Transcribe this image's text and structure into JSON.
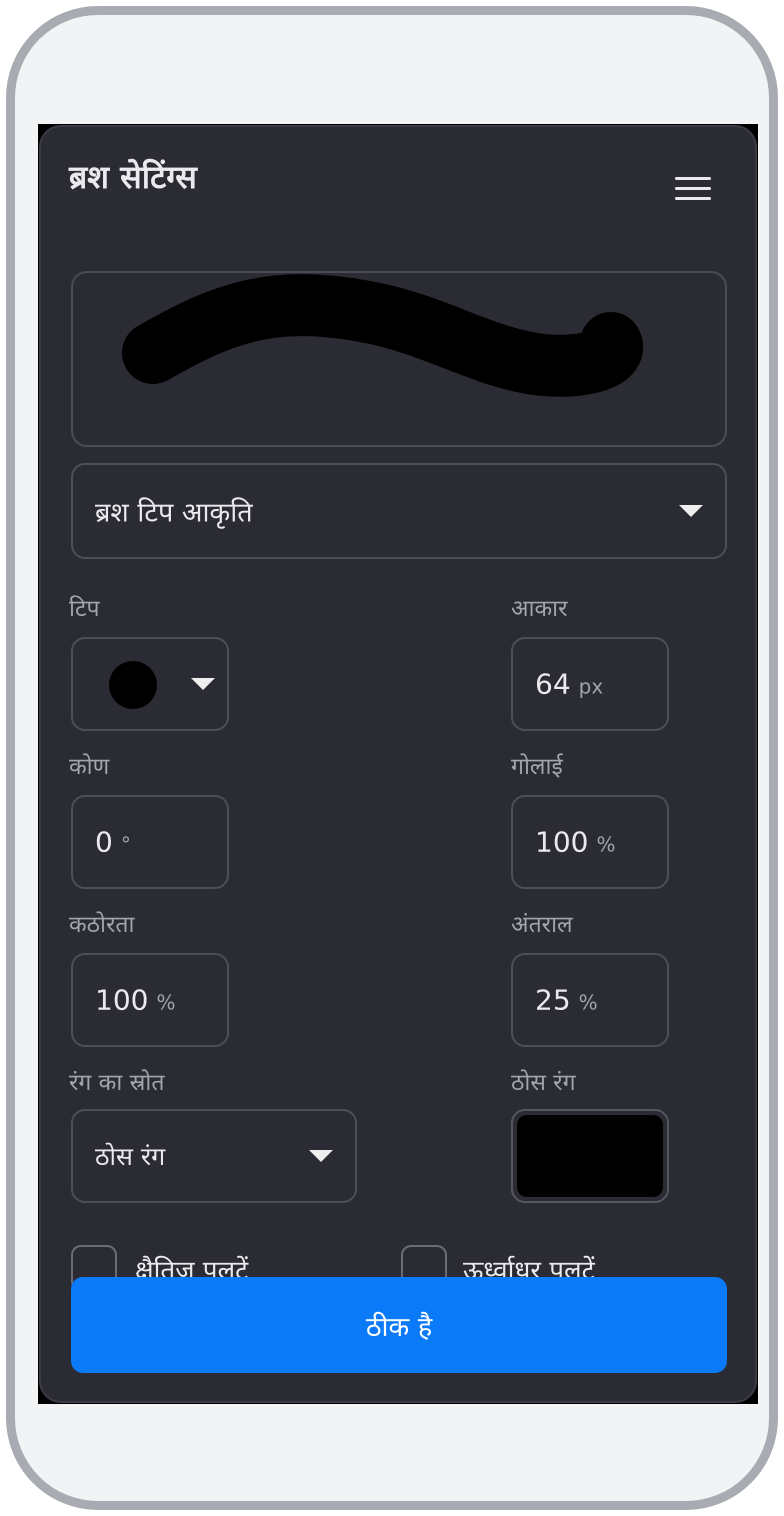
{
  "dialog": {
    "title": "ब्रश सेटिंग्स",
    "menu_icon": "hamburger-menu-icon"
  },
  "brush_tip_shape": {
    "selected": "ब्रश टिप आकृति"
  },
  "tip": {
    "label": "टिप",
    "shape_icon": "round-tip-icon"
  },
  "size": {
    "label": "आकार",
    "value": "64",
    "unit": "px"
  },
  "angle": {
    "label": "कोण",
    "value": "0",
    "unit": "°"
  },
  "roundness": {
    "label": "गोलाई",
    "value": "100",
    "unit": "%"
  },
  "hardness": {
    "label": "कठोरता",
    "value": "100",
    "unit": "%"
  },
  "spacing": {
    "label": "अंतराल",
    "value": "25",
    "unit": "%"
  },
  "color_source": {
    "label": "रंग का स्रोत",
    "selected": "ठोस रंग"
  },
  "solid_color": {
    "label": "ठोस रंग",
    "color": "#000000"
  },
  "flip": {
    "horizontal_label": "क्षैतिज पलटें",
    "vertical_label": "ऊर्ध्वाधर पलटें"
  },
  "actions": {
    "ok_label": "ठीक है"
  },
  "colors": {
    "panel_bg": "#2b2c33",
    "accent": "#0a7af9",
    "text": "#e9e9ee",
    "muted_text": "#a3a4ad"
  }
}
